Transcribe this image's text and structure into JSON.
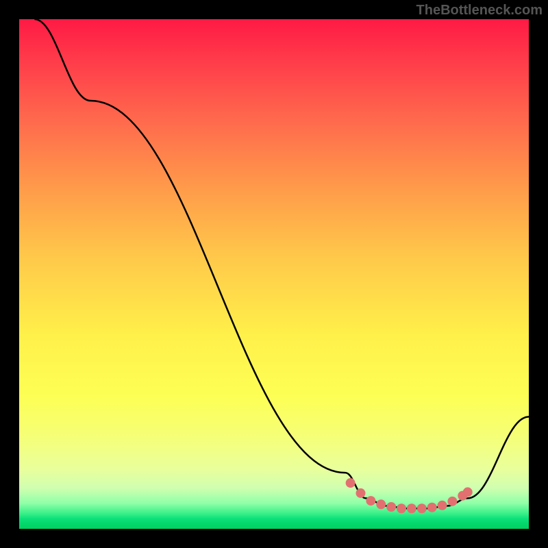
{
  "watermark": "TheBottleneck.com",
  "chart_data": {
    "type": "line",
    "title": "",
    "xlabel": "",
    "ylabel": "",
    "xlim": [
      0,
      100
    ],
    "ylim": [
      0,
      100
    ],
    "series": [
      {
        "name": "bottleneck-curve",
        "color": "#000000",
        "points": [
          {
            "x": 3,
            "y": 100
          },
          {
            "x": 14,
            "y": 84
          },
          {
            "x": 64,
            "y": 11
          },
          {
            "x": 68,
            "y": 6
          },
          {
            "x": 72,
            "y": 4.5
          },
          {
            "x": 76,
            "y": 4
          },
          {
            "x": 80,
            "y": 4
          },
          {
            "x": 84,
            "y": 4.5
          },
          {
            "x": 88,
            "y": 6
          },
          {
            "x": 100,
            "y": 22
          }
        ]
      },
      {
        "name": "highlight-dots",
        "color": "#e27070",
        "points": [
          {
            "x": 65,
            "y": 9
          },
          {
            "x": 67,
            "y": 7
          },
          {
            "x": 69,
            "y": 5.5
          },
          {
            "x": 71,
            "y": 4.8
          },
          {
            "x": 73,
            "y": 4.3
          },
          {
            "x": 75,
            "y": 4
          },
          {
            "x": 77,
            "y": 4
          },
          {
            "x": 79,
            "y": 4
          },
          {
            "x": 81,
            "y": 4.2
          },
          {
            "x": 83,
            "y": 4.6
          },
          {
            "x": 85,
            "y": 5.4
          },
          {
            "x": 87,
            "y": 6.5
          },
          {
            "x": 88,
            "y": 7.2
          }
        ]
      }
    ]
  }
}
